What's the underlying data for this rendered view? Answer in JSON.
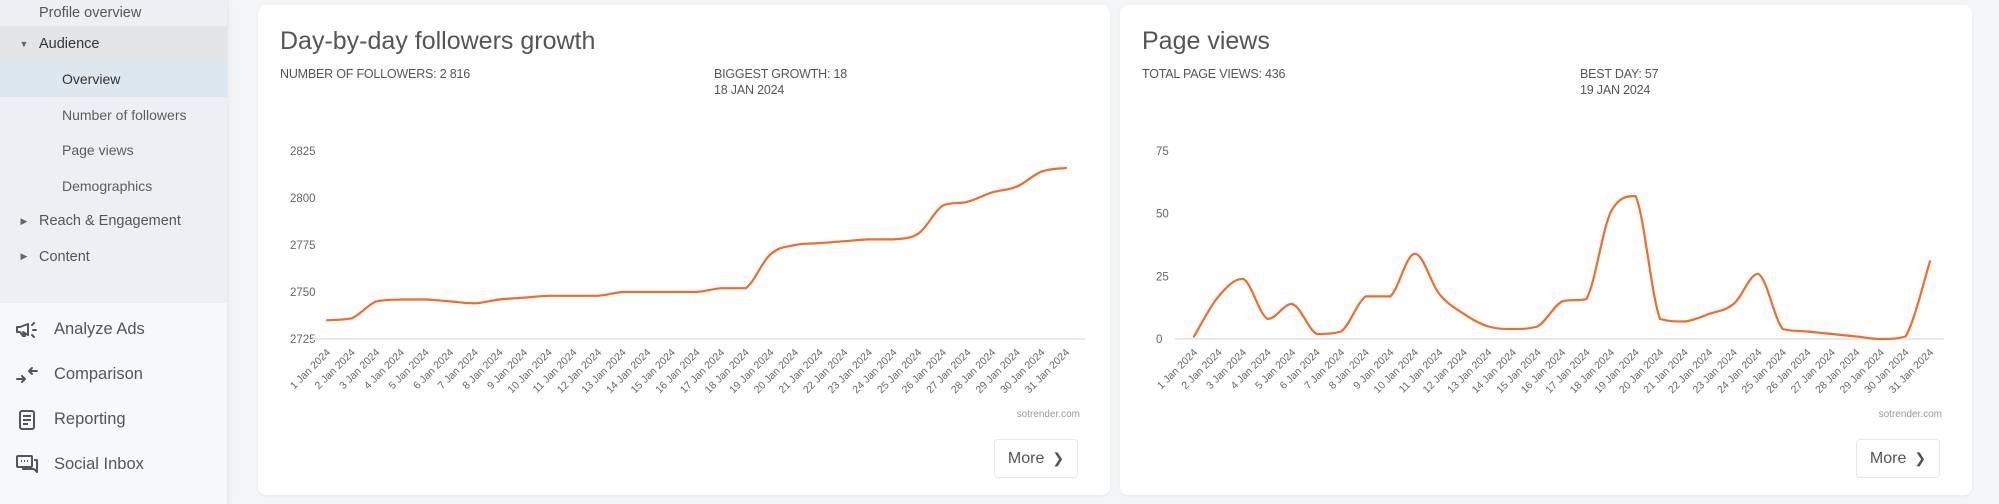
{
  "sidebar": {
    "sub_items": [
      {
        "label": "Profile overview",
        "level": 1,
        "state": "normal"
      },
      {
        "label": "Audience",
        "level": 1,
        "state": "expanded",
        "caret": "caret-down"
      },
      {
        "label": "Overview",
        "level": 2,
        "state": "active"
      },
      {
        "label": "Number of followers",
        "level": 2,
        "state": "normal"
      },
      {
        "label": "Page views",
        "level": 2,
        "state": "normal"
      },
      {
        "label": "Demographics",
        "level": 2,
        "state": "normal"
      },
      {
        "label": "Reach & Engagement",
        "level": 1,
        "state": "collapsed",
        "caret": "caret-right"
      },
      {
        "label": "Content",
        "level": 1,
        "state": "collapsed",
        "caret": "caret-right"
      }
    ],
    "main_items": [
      {
        "label": "Analyze Ads",
        "icon": "megaphone-icon"
      },
      {
        "label": "Comparison",
        "icon": "compare-arrows-icon"
      },
      {
        "label": "Reporting",
        "icon": "report-icon"
      },
      {
        "label": "Social Inbox",
        "icon": "chat-bubbles-icon"
      }
    ]
  },
  "cards": [
    {
      "title": "Day-by-day followers growth",
      "stat1": "NUMBER OF FOLLOWERS: 2 816",
      "stat2_line1": "BIGGEST GROWTH: 18",
      "stat2_line2": "18 JAN 2024",
      "watermark": "sotrender.com",
      "more_label": "More"
    },
    {
      "title": "Page views",
      "stat1": "TOTAL PAGE VIEWS: 436",
      "stat2_line1": "BEST DAY: 57",
      "stat2_line2": "19 JAN 2024",
      "watermark": "sotrender.com",
      "more_label": "More"
    }
  ],
  "colors": {
    "line": "#f26b2a",
    "axis": "#e4e9f2",
    "tick_text": "#666666"
  },
  "chart_data": [
    {
      "type": "line",
      "title": "Day-by-day followers growth",
      "xlabel": "",
      "ylabel": "",
      "x": [
        "1 Jan 2024",
        "2 Jan 2024",
        "3 Jan 2024",
        "4 Jan 2024",
        "5 Jan 2024",
        "6 Jan 2024",
        "7 Jan 2024",
        "8 Jan 2024",
        "9 Jan 2024",
        "10 Jan 2024",
        "11 Jan 2024",
        "12 Jan 2024",
        "13 Jan 2024",
        "14 Jan 2024",
        "15 Jan 2024",
        "16 Jan 2024",
        "17 Jan 2024",
        "18 Jan 2024",
        "19 Jan 2024",
        "20 Jan 2024",
        "21 Jan 2024",
        "22 Jan 2024",
        "23 Jan 2024",
        "24 Jan 2024",
        "25 Jan 2024",
        "26 Jan 2024",
        "27 Jan 2024",
        "28 Jan 2024",
        "29 Jan 2024",
        "30 Jan 2024",
        "31 Jan 2024"
      ],
      "series": [
        {
          "name": "Followers",
          "values": [
            2735,
            2736,
            2745,
            2746,
            2746,
            2745,
            2744,
            2746,
            2747,
            2748,
            2748,
            2748,
            2750,
            2750,
            2750,
            2750,
            2752,
            2752,
            2770,
            2775,
            2776,
            2777,
            2778,
            2778,
            2781,
            2796,
            2798,
            2803,
            2806,
            2814,
            2816
          ]
        }
      ],
      "ylim": [
        2725,
        2825
      ],
      "yticks": [
        2725,
        2750,
        2775,
        2800,
        2825
      ],
      "grid": false,
      "legend": "none"
    },
    {
      "type": "line",
      "title": "Page views",
      "xlabel": "",
      "ylabel": "",
      "x": [
        "1 Jan 2024",
        "2 Jan 2024",
        "3 Jan 2024",
        "4 Jan 2024",
        "5 Jan 2024",
        "6 Jan 2024",
        "7 Jan 2024",
        "8 Jan 2024",
        "9 Jan 2024",
        "10 Jan 2024",
        "11 Jan 2024",
        "12 Jan 2024",
        "13 Jan 2024",
        "14 Jan 2024",
        "15 Jan 2024",
        "16 Jan 2024",
        "17 Jan 2024",
        "18 Jan 2024",
        "19 Jan 2024",
        "20 Jan 2024",
        "21 Jan 2024",
        "22 Jan 2024",
        "23 Jan 2024",
        "24 Jan 2024",
        "25 Jan 2024",
        "26 Jan 2024",
        "27 Jan 2024",
        "28 Jan 2024",
        "29 Jan 2024",
        "30 Jan 2024",
        "31 Jan 2024"
      ],
      "series": [
        {
          "name": "Page views",
          "values": [
            1,
            17,
            24,
            8,
            14,
            2,
            3,
            17,
            17,
            34,
            18,
            10,
            5,
            4,
            5,
            15,
            16,
            51,
            57,
            8,
            7,
            10,
            14,
            26,
            4,
            3,
            2,
            1,
            0,
            1,
            31
          ]
        }
      ],
      "ylim": [
        0,
        75
      ],
      "yticks": [
        0,
        25,
        50,
        75
      ],
      "grid": false,
      "legend": "none"
    }
  ]
}
